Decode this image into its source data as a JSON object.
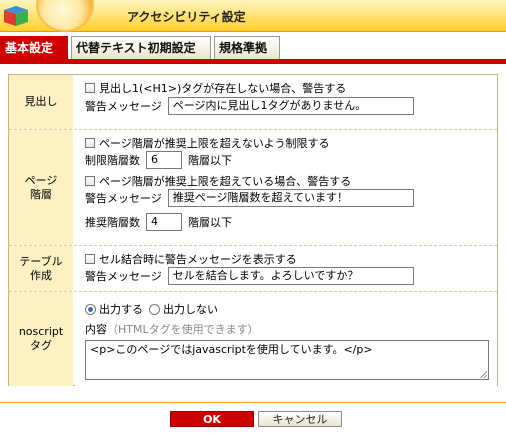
{
  "header": {
    "title": "アクセシビリティ設定"
  },
  "tabs": [
    {
      "label": "基本設定",
      "active": true
    },
    {
      "label": "代替テキスト初期設定",
      "active": false
    },
    {
      "label": "規格準拠",
      "active": false
    }
  ],
  "sections": {
    "heading": {
      "label": "見出し",
      "checkbox_label": "見出し1(<H1>)タグが存在しない場合、警告する",
      "checked": false,
      "warning_label": "警告メッセージ",
      "warning_value": "ページ内に見出し1タグがありません。"
    },
    "page_depth": {
      "label_line1": "ページ",
      "label_line2": "階層",
      "limit_checkbox_label": "ページ階層が推奨上限を超えないよう制限する",
      "limit_checked": false,
      "limit_depth_label": "制限階層数",
      "limit_depth_value": "6",
      "limit_depth_suffix": "階層以下",
      "warn_checkbox_label": "ページ階層が推奨上限を超えている場合、警告する",
      "warn_checked": false,
      "warning_label": "警告メッセージ",
      "warning_value": "推奨ページ階層数を超えています！",
      "recommended_depth_label": "推奨階層数",
      "recommended_depth_value": "4",
      "recommended_depth_suffix": "階層以下"
    },
    "table": {
      "label_line1": "テーブル",
      "label_line2": "作成",
      "checkbox_label": "セル結合時に警告メッセージを表示する",
      "checked": false,
      "warning_label": "警告メッセージ",
      "warning_value": "セルを結合します。よろしいですか？"
    },
    "noscript": {
      "label_line1": "noscript",
      "label_line2": "タグ",
      "radio_output": "出力する",
      "radio_no_output": "出力しない",
      "selected": "出力する",
      "content_label": "内容",
      "content_hint": "（HTMLタグを使用できます）",
      "content_value": "<p>このページではjavascriptを使用しています。</p>"
    }
  },
  "footer": {
    "ok_label": "OK",
    "cancel_label": "キャンセル"
  },
  "colors": {
    "accent": "#cc0000",
    "label_bg": "#fdf1c4",
    "header_gold": "#ffcf2a"
  }
}
